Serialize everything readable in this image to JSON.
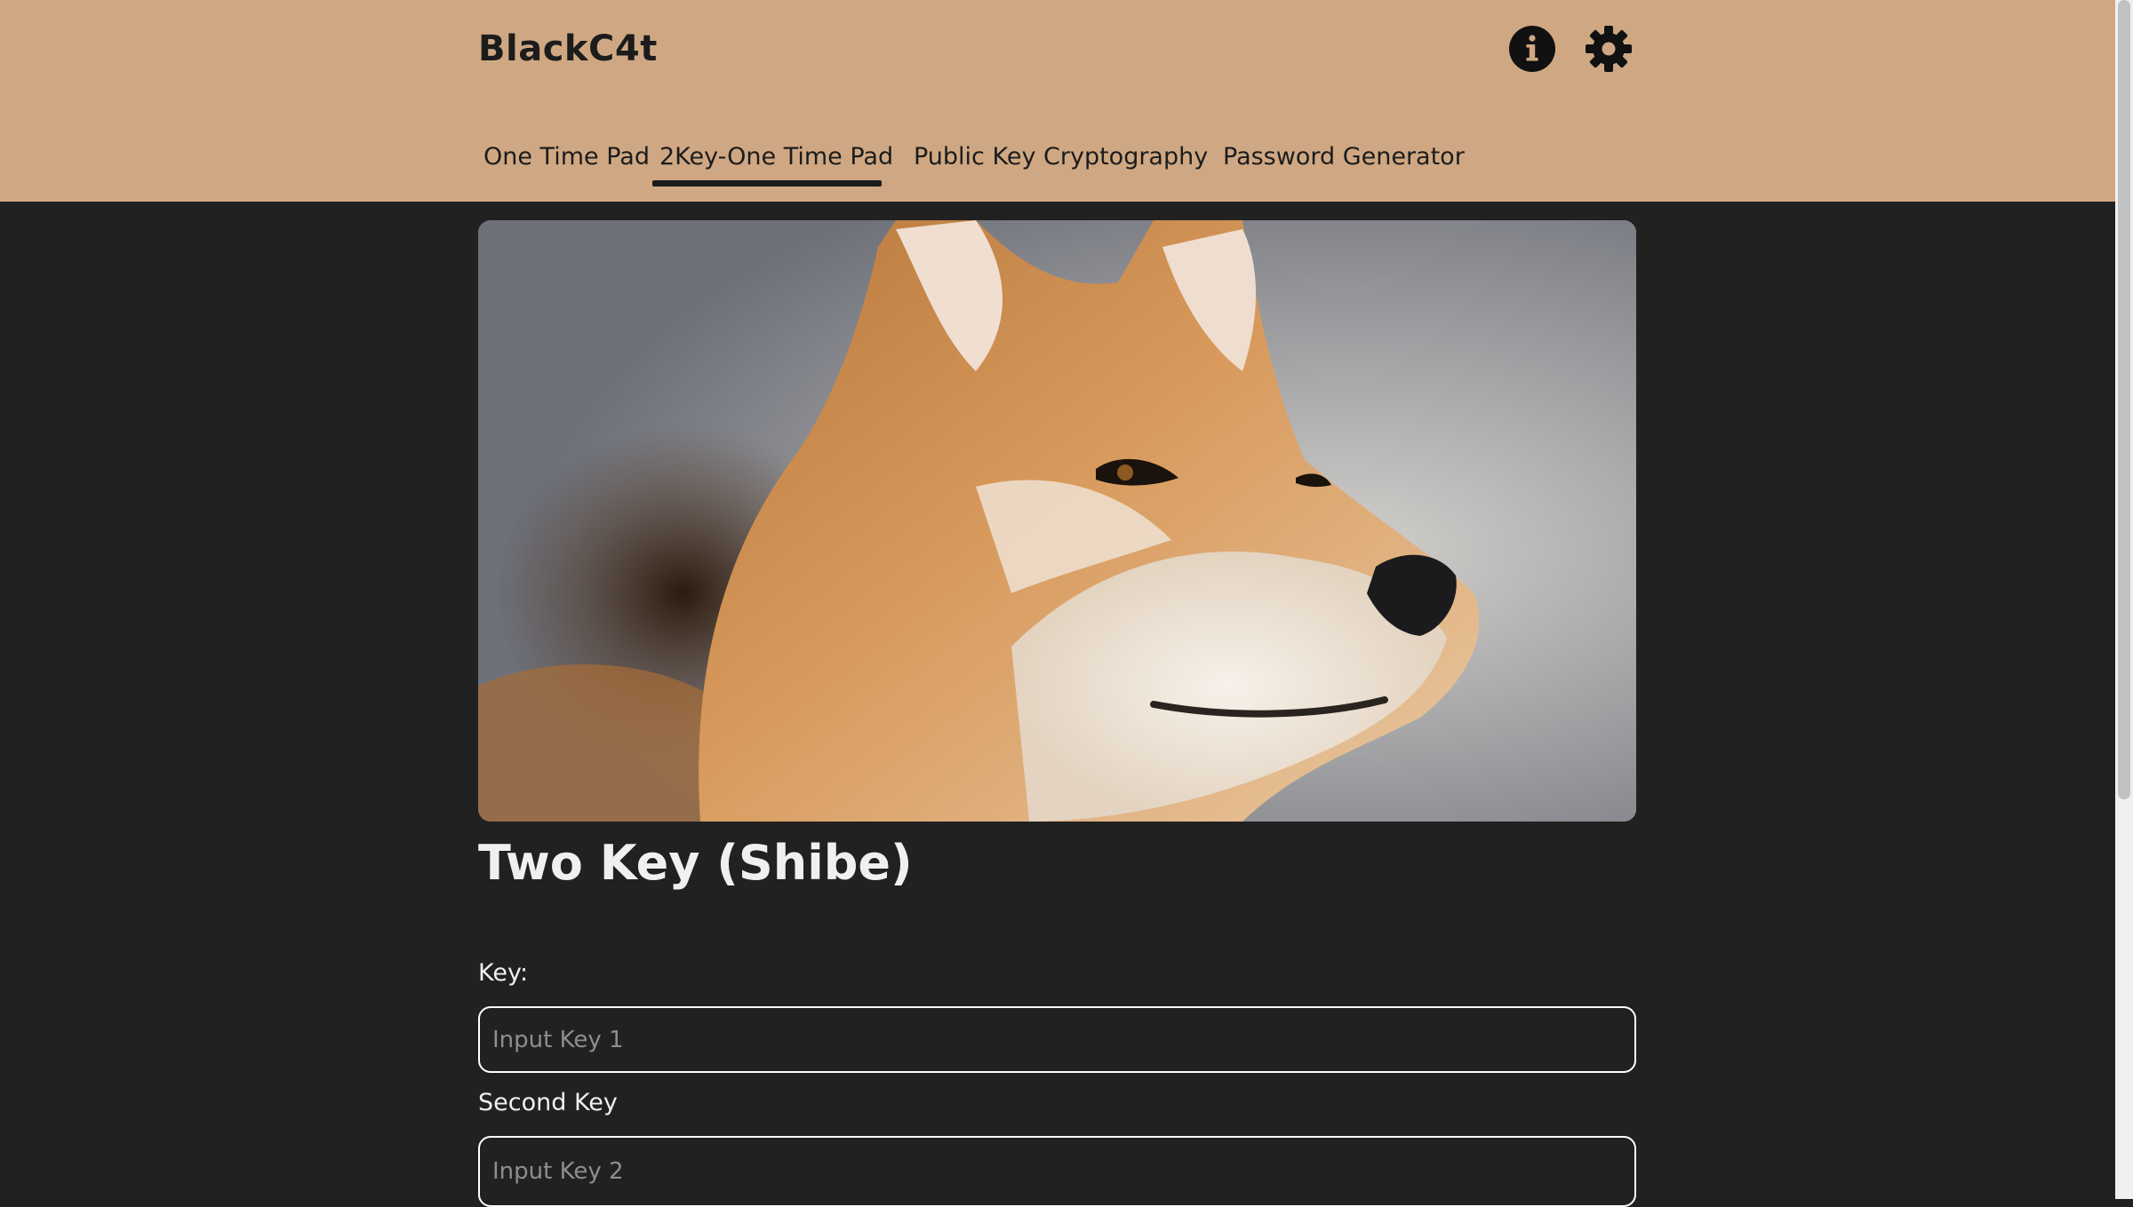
{
  "header": {
    "brand": "BlackC4t",
    "icons": {
      "info": "info-icon",
      "settings": "gear-icon"
    },
    "tabs": [
      {
        "label": "One Time Pad",
        "active": false
      },
      {
        "label": "2Key-One Time Pad",
        "active": true
      },
      {
        "label": "Public Key Cryptography",
        "active": false
      },
      {
        "label": "Password Generator",
        "active": false
      }
    ]
  },
  "main": {
    "hero_image": "shiba-inu-photo",
    "title": "Two Key (Shibe)",
    "fields": [
      {
        "label": "Key:",
        "value": "",
        "placeholder": "Input Key 1"
      },
      {
        "label": "Second Key",
        "value": "",
        "placeholder": "Input Key 2"
      }
    ]
  },
  "colors": {
    "header_bg": "#cfa883",
    "page_bg": "#212121",
    "text_dark": "#1c1c1c",
    "text_light": "#f0f0f0"
  }
}
